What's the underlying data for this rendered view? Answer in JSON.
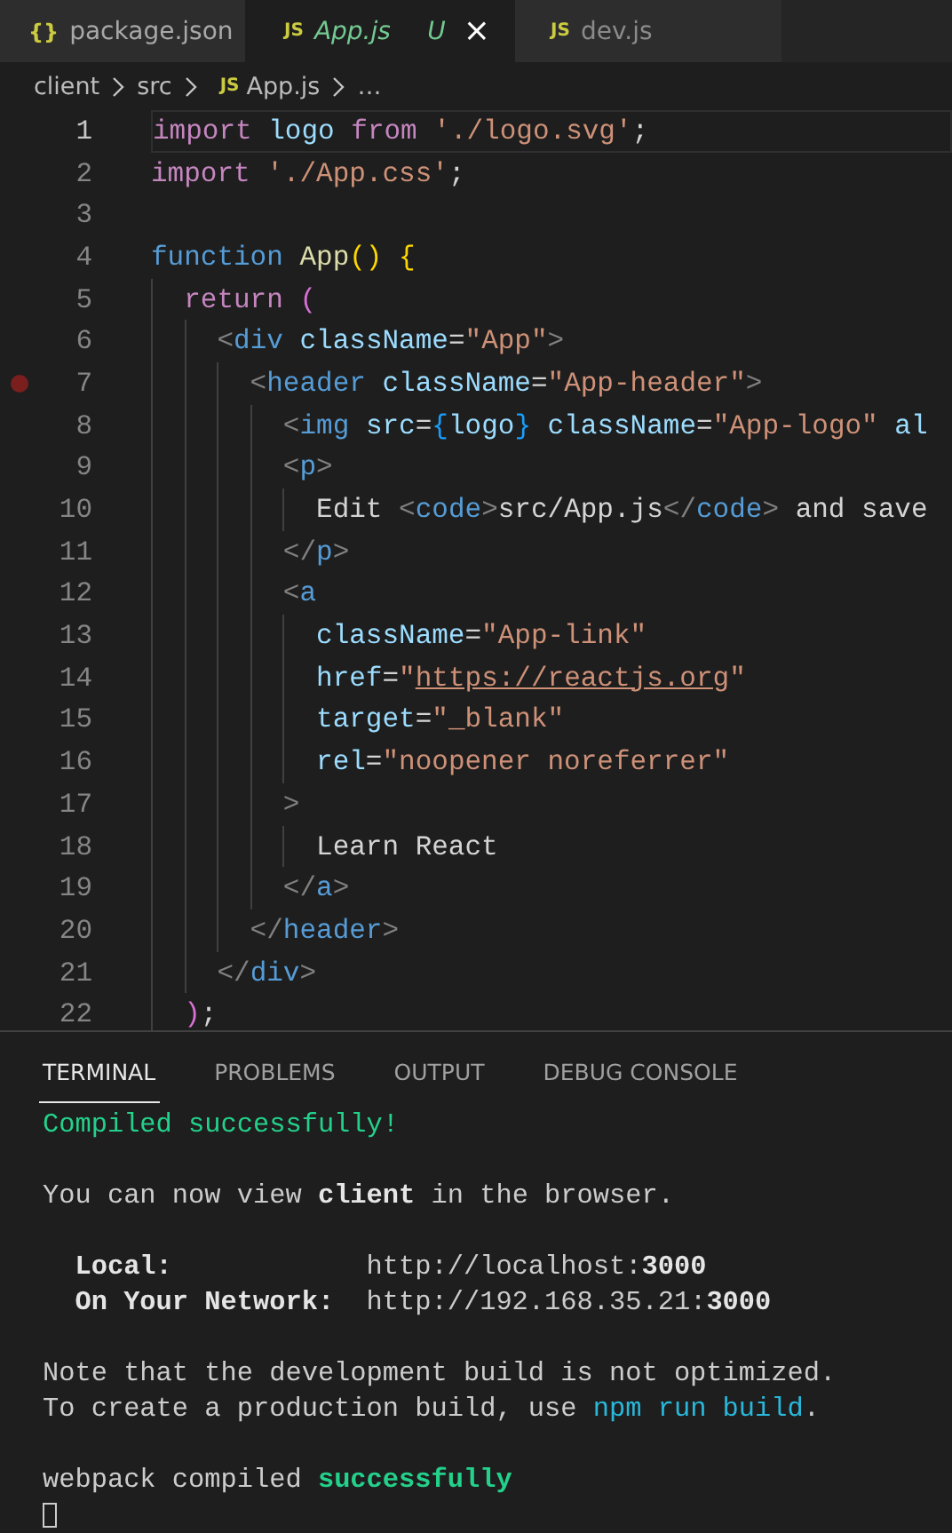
{
  "tabs": [
    {
      "icon": "{}",
      "kind": "json",
      "label": "package.json",
      "selected": false,
      "untracked": false
    },
    {
      "icon": "JS",
      "kind": "js",
      "label": "App.js",
      "selected": true,
      "untracked": true,
      "status": "U",
      "close": "×"
    },
    {
      "icon": "JS",
      "kind": "js",
      "label": "dev.js",
      "selected": false,
      "untracked": false
    }
  ],
  "breadcrumb": [
    {
      "label": "client"
    },
    {
      "label": "src"
    },
    {
      "icon": "JS",
      "label": "App.js"
    },
    {
      "label": "…"
    }
  ],
  "code_lines": [
    {
      "number": "1",
      "current": true,
      "breakpoint": false,
      "tokens": [
        {
          "kind": "keyword",
          "text": "import "
        },
        {
          "kind": "var",
          "text": "logo "
        },
        {
          "kind": "keyword",
          "text": "from "
        },
        {
          "kind": "str",
          "text": "'./logo.svg'"
        },
        {
          "kind": "plain",
          "text": ";"
        }
      ]
    },
    {
      "number": "2",
      "current": false,
      "breakpoint": false,
      "tokens": [
        {
          "kind": "keyword",
          "text": "import "
        },
        {
          "kind": "str",
          "text": "'./App.css'"
        },
        {
          "kind": "plain",
          "text": ";"
        }
      ]
    },
    {
      "number": "3",
      "current": false,
      "breakpoint": false
    },
    {
      "number": "4",
      "current": false,
      "breakpoint": false,
      "tokens": [
        {
          "kind": "storage",
          "text": "function "
        },
        {
          "kind": "fn",
          "text": "App"
        },
        {
          "kind": "gold",
          "text": "() {"
        }
      ]
    },
    {
      "number": "5",
      "current": false,
      "breakpoint": false,
      "tokens": [
        {
          "kind": "keyword",
          "text": "  return "
        },
        {
          "kind": "pink",
          "text": "("
        }
      ]
    },
    {
      "number": "6",
      "current": false,
      "breakpoint": false,
      "tokens": [
        {
          "kind": "tagp",
          "text": "    <"
        },
        {
          "kind": "tag",
          "text": "div "
        },
        {
          "kind": "var",
          "text": "className"
        },
        {
          "kind": "plain",
          "text": "="
        },
        {
          "kind": "str",
          "text": "\"App\""
        },
        {
          "kind": "tagp",
          "text": ">"
        }
      ]
    },
    {
      "number": "7",
      "current": false,
      "breakpoint": true,
      "tokens": [
        {
          "kind": "tagp",
          "text": "      <"
        },
        {
          "kind": "tag",
          "text": "header "
        },
        {
          "kind": "var",
          "text": "className"
        },
        {
          "kind": "plain",
          "text": "="
        },
        {
          "kind": "str",
          "text": "\"App-header\""
        },
        {
          "kind": "tagp",
          "text": ">"
        }
      ]
    },
    {
      "number": "8",
      "current": false,
      "breakpoint": false,
      "tokens": [
        {
          "kind": "tagp",
          "text": "        <"
        },
        {
          "kind": "tag",
          "text": "img "
        },
        {
          "kind": "var",
          "text": "src"
        },
        {
          "kind": "plain",
          "text": "="
        },
        {
          "kind": "blue",
          "text": "{"
        },
        {
          "kind": "var",
          "text": "logo"
        },
        {
          "kind": "blue",
          "text": "} "
        },
        {
          "kind": "var",
          "text": "className"
        },
        {
          "kind": "plain",
          "text": "="
        },
        {
          "kind": "str",
          "text": "\"App-logo\" "
        },
        {
          "kind": "var",
          "text": "al"
        }
      ]
    },
    {
      "number": "9",
      "current": false,
      "breakpoint": false,
      "tokens": [
        {
          "kind": "tagp",
          "text": "        <"
        },
        {
          "kind": "tag",
          "text": "p"
        },
        {
          "kind": "tagp",
          "text": ">"
        }
      ]
    },
    {
      "number": "10",
      "current": false,
      "breakpoint": false,
      "tokens": [
        {
          "kind": "plain",
          "text": "          Edit "
        },
        {
          "kind": "tagp",
          "text": "<"
        },
        {
          "kind": "tag",
          "text": "code"
        },
        {
          "kind": "tagp",
          "text": ">"
        },
        {
          "kind": "plain",
          "text": "src/App.js"
        },
        {
          "kind": "tagp",
          "text": "</"
        },
        {
          "kind": "tag",
          "text": "code"
        },
        {
          "kind": "tagp",
          "text": ">"
        },
        {
          "kind": "plain",
          "text": " and save"
        }
      ]
    },
    {
      "number": "11",
      "current": false,
      "breakpoint": false,
      "tokens": [
        {
          "kind": "tagp",
          "text": "        </"
        },
        {
          "kind": "tag",
          "text": "p"
        },
        {
          "kind": "tagp",
          "text": ">"
        }
      ]
    },
    {
      "number": "12",
      "current": false,
      "breakpoint": false,
      "tokens": [
        {
          "kind": "tagp",
          "text": "        <"
        },
        {
          "kind": "tag",
          "text": "a"
        }
      ]
    },
    {
      "number": "13",
      "current": false,
      "breakpoint": false,
      "tokens": [
        {
          "kind": "var",
          "text": "          className"
        },
        {
          "kind": "plain",
          "text": "="
        },
        {
          "kind": "str",
          "text": "\"App-link\""
        }
      ]
    },
    {
      "number": "14",
      "current": false,
      "breakpoint": false,
      "tokens": [
        {
          "kind": "var",
          "text": "          href"
        },
        {
          "kind": "plain",
          "text": "="
        },
        {
          "kind": "str",
          "text": "\""
        },
        {
          "kind": "link",
          "text": "https://reactjs.org"
        },
        {
          "kind": "str",
          "text": "\""
        }
      ]
    },
    {
      "number": "15",
      "current": false,
      "breakpoint": false,
      "tokens": [
        {
          "kind": "var",
          "text": "          target"
        },
        {
          "kind": "plain",
          "text": "="
        },
        {
          "kind": "str",
          "text": "\"_blank\""
        }
      ]
    },
    {
      "number": "16",
      "current": false,
      "breakpoint": false,
      "tokens": [
        {
          "kind": "var",
          "text": "          rel"
        },
        {
          "kind": "plain",
          "text": "="
        },
        {
          "kind": "str",
          "text": "\"noopener noreferrer\""
        }
      ]
    },
    {
      "number": "17",
      "current": false,
      "breakpoint": false,
      "tokens": [
        {
          "kind": "tagp",
          "text": "        >"
        }
      ]
    },
    {
      "number": "18",
      "current": false,
      "breakpoint": false,
      "tokens": [
        {
          "kind": "plain",
          "text": "          Learn React"
        }
      ]
    },
    {
      "number": "19",
      "current": false,
      "breakpoint": false,
      "tokens": [
        {
          "kind": "tagp",
          "text": "        </"
        },
        {
          "kind": "tag",
          "text": "a"
        },
        {
          "kind": "tagp",
          "text": ">"
        }
      ]
    },
    {
      "number": "20",
      "current": false,
      "breakpoint": false,
      "tokens": [
        {
          "kind": "tagp",
          "text": "      </"
        },
        {
          "kind": "tag",
          "text": "header"
        },
        {
          "kind": "tagp",
          "text": ">"
        }
      ]
    },
    {
      "number": "21",
      "current": false,
      "breakpoint": false,
      "tokens": [
        {
          "kind": "tagp",
          "text": "    </"
        },
        {
          "kind": "tag",
          "text": "div"
        },
        {
          "kind": "tagp",
          "text": ">"
        }
      ]
    },
    {
      "number": "22",
      "current": false,
      "breakpoint": false,
      "tokens": [
        {
          "kind": "pink",
          "text": "  )"
        },
        {
          "kind": "plain",
          "text": ";"
        }
      ]
    }
  ],
  "panel_tabs": [
    {
      "label": "TERMINAL",
      "selected": true
    },
    {
      "label": "PROBLEMS",
      "selected": false
    },
    {
      "label": "OUTPUT",
      "selected": false
    },
    {
      "label": "DEBUG CONSOLE",
      "selected": false
    }
  ],
  "terminal_lines": [
    {
      "kind": "text",
      "segments": [
        {
          "kind": "success",
          "text": "Compiled successfully!"
        }
      ]
    },
    {
      "kind": "blank"
    },
    {
      "kind": "text",
      "segments": [
        {
          "kind": "plain",
          "text": "You can now view "
        },
        {
          "kind": "bold",
          "text": "client"
        },
        {
          "kind": "plain",
          "text": " in the browser."
        }
      ]
    },
    {
      "kind": "blank"
    },
    {
      "kind": "text",
      "segments": [
        {
          "kind": "bold",
          "text": "  Local:            "
        },
        {
          "kind": "plain",
          "text": "http://localhost:"
        },
        {
          "kind": "bold",
          "text": "3000"
        }
      ]
    },
    {
      "kind": "text",
      "segments": [
        {
          "kind": "bold",
          "text": "  On Your Network:  "
        },
        {
          "kind": "plain",
          "text": "http://192.168.35.21:"
        },
        {
          "kind": "bold",
          "text": "3000"
        }
      ]
    },
    {
      "kind": "blank"
    },
    {
      "kind": "text",
      "segments": [
        {
          "kind": "plain",
          "text": "Note that the development build is not optimized."
        }
      ]
    },
    {
      "kind": "text",
      "segments": [
        {
          "kind": "plain",
          "text": "To create a production build, use "
        },
        {
          "kind": "info",
          "text": "npm run build"
        },
        {
          "kind": "plain",
          "text": "."
        }
      ]
    },
    {
      "kind": "blank"
    },
    {
      "kind": "text",
      "segments": [
        {
          "kind": "plain",
          "text": "webpack compiled "
        },
        {
          "kind": "success-bold",
          "text": "successfully"
        }
      ]
    }
  ],
  "terminal_cursor": true
}
